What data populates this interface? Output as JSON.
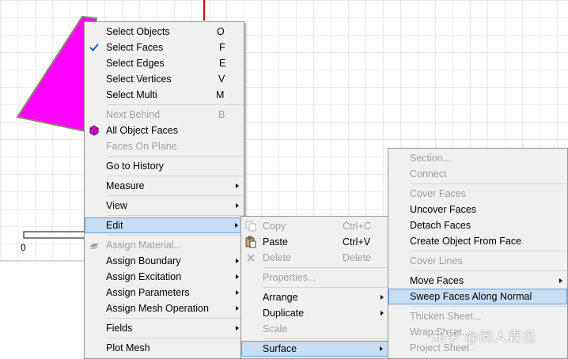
{
  "viewport": {
    "ruler_label": "0",
    "colors": {
      "face": "#ff00ff",
      "grid": "#d9d9d9",
      "axis_red": "#d00000",
      "highlight": "#c7def5"
    }
  },
  "main_menu": {
    "items": [
      {
        "label": "Select Objects",
        "shortcut": "O"
      },
      {
        "label": "Select Faces",
        "shortcut": "F",
        "checked": true
      },
      {
        "label": "Select Edges",
        "shortcut": "E"
      },
      {
        "label": "Select Vertices",
        "shortcut": "V"
      },
      {
        "label": "Select Multi",
        "shortcut": "M"
      },
      {
        "label": "Next Behind",
        "shortcut": "B",
        "disabled": true
      },
      {
        "label": "All Object Faces",
        "icon": "cube-icon"
      },
      {
        "label": "Faces On Plane",
        "disabled": true
      },
      {
        "label": "Go to History"
      },
      {
        "label": "Measure"
      },
      {
        "label": "View"
      },
      {
        "label": "Edit"
      },
      {
        "label": "Assign Material...",
        "disabled": true,
        "icon": "material-icon"
      },
      {
        "label": "Assign Boundary"
      },
      {
        "label": "Assign Excitation"
      },
      {
        "label": "Assign Parameters"
      },
      {
        "label": "Assign Mesh Operation"
      },
      {
        "label": "Fields"
      },
      {
        "label": "Plot Mesh"
      }
    ]
  },
  "edit_menu": {
    "items": [
      {
        "label": "Copy",
        "shortcut": "Ctrl+C",
        "disabled": true,
        "icon": "copy-icon"
      },
      {
        "label": "Paste",
        "shortcut": "Ctrl+V",
        "icon": "paste-icon"
      },
      {
        "label": "Delete",
        "shortcut": "Delete",
        "disabled": true,
        "icon": "delete-icon"
      },
      {
        "label": "Properties...",
        "disabled": true
      },
      {
        "label": "Arrange"
      },
      {
        "label": "Duplicate"
      },
      {
        "label": "Scale",
        "disabled": true
      },
      {
        "label": "Surface"
      }
    ]
  },
  "surface_menu": {
    "items": [
      {
        "label": "Section...",
        "disabled": true
      },
      {
        "label": "Connect",
        "disabled": true
      },
      {
        "label": "Cover Faces",
        "disabled": true
      },
      {
        "label": "Uncover Faces"
      },
      {
        "label": "Detach Faces"
      },
      {
        "label": "Create Object From Face"
      },
      {
        "label": "Cover Lines",
        "disabled": true
      },
      {
        "label": "Move Faces"
      },
      {
        "label": "Sweep Faces Along Normal"
      },
      {
        "label": "Thicken Sheet...",
        "disabled": true
      },
      {
        "label": "Wrap Sheet...",
        "disabled": true
      },
      {
        "label": "Project Sheet",
        "disabled": true
      }
    ]
  },
  "watermark": "知乎 @闻人霖远"
}
